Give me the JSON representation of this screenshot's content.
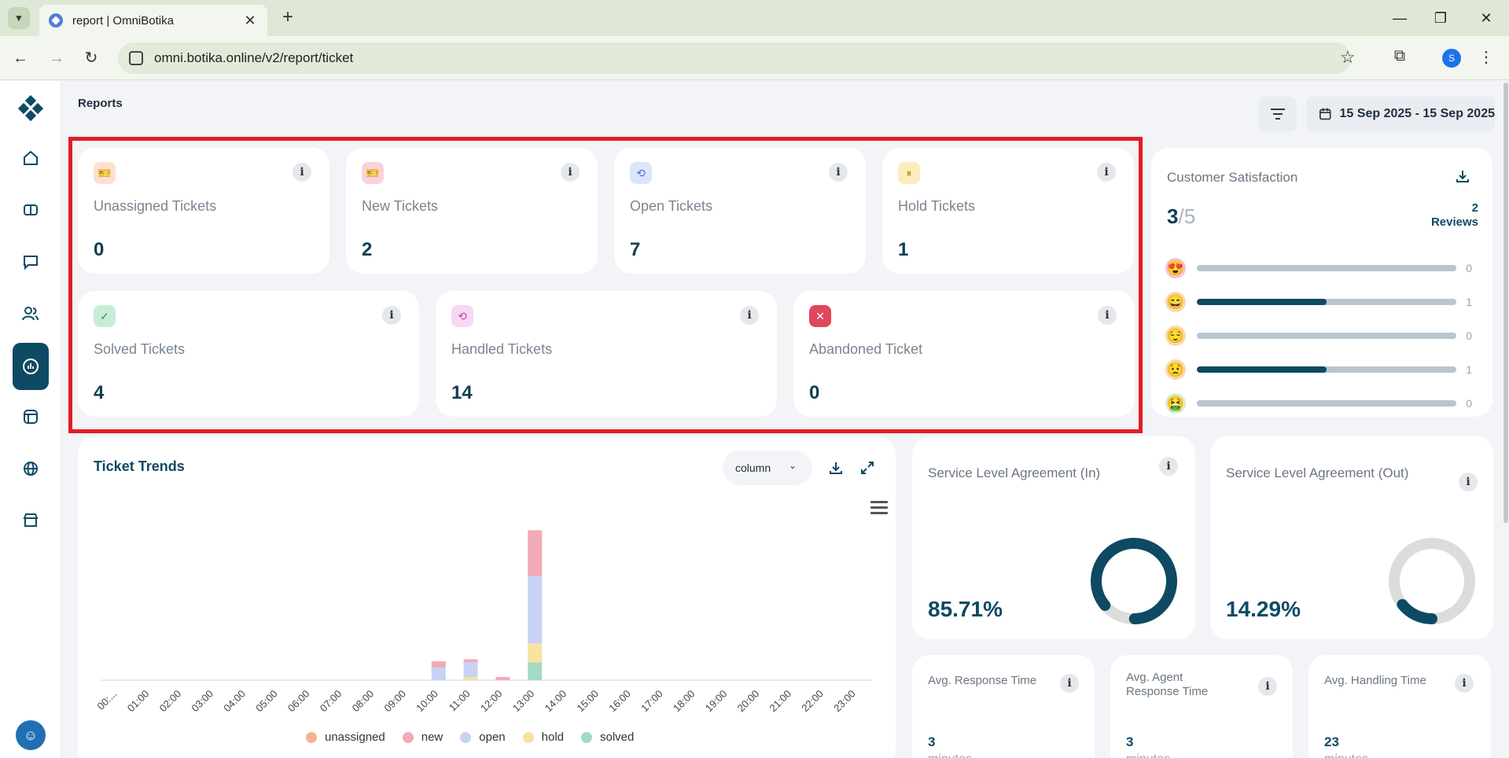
{
  "browser": {
    "tab_title": "report | OmniBotika",
    "url": "omni.botika.online/v2/report/ticket",
    "profile_initial": "S"
  },
  "page": {
    "title": "Reports",
    "date_range": "15 Sep 2025 - 15 Sep 2025"
  },
  "stats": [
    {
      "label": "Unassigned Tickets",
      "value": "0",
      "icon": "ticket-icon",
      "color": "#f6b48e"
    },
    {
      "label": "New Tickets",
      "value": "2",
      "icon": "ticket-new-icon",
      "color": "#f29aa8"
    },
    {
      "label": "Open Tickets",
      "value": "7",
      "icon": "ticket-open-icon",
      "color": "#b4c6f4"
    },
    {
      "label": "Hold Tickets",
      "value": "1",
      "icon": "ticket-hold-icon",
      "color": "#f5dc8a"
    },
    {
      "label": "Solved Tickets",
      "value": "4",
      "icon": "ticket-solved-icon",
      "color": "#8fd3a8"
    },
    {
      "label": "Handled Tickets",
      "value": "14",
      "icon": "ticket-handled-icon",
      "color": "#eab1e6"
    },
    {
      "label": "Abandoned Ticket",
      "value": "0",
      "icon": "ticket-abandoned-icon",
      "color": "#e0475a"
    }
  ],
  "satisfaction": {
    "title": "Customer Satisfaction",
    "score": "3",
    "score_max": "/5",
    "reviews_count": "2",
    "reviews_label": "Reviews",
    "rows": [
      {
        "emoji": "😍",
        "count": "0",
        "fill": 0
      },
      {
        "emoji": "😄",
        "count": "1",
        "fill": 0.5
      },
      {
        "emoji": "😌",
        "count": "0",
        "fill": 0
      },
      {
        "emoji": "😟",
        "count": "1",
        "fill": 0.5
      },
      {
        "emoji": "🤮",
        "count": "0",
        "fill": 0
      }
    ]
  },
  "trends": {
    "title": "Ticket Trends",
    "chart_type_select": "column"
  },
  "chart_data": {
    "type": "bar",
    "stacked": true,
    "categories": [
      "00:...",
      "01:00",
      "02:00",
      "03:00",
      "04:00",
      "05:00",
      "06:00",
      "07:00",
      "08:00",
      "09:00",
      "10:00",
      "11:00",
      "12:00",
      "13:00",
      "14:00",
      "15:00",
      "16:00",
      "17:00",
      "18:00",
      "19:00",
      "20:00",
      "21:00",
      "22:00",
      "23:00"
    ],
    "series": [
      {
        "name": "unassigned",
        "color": "#f6b48e",
        "values": [
          0,
          0,
          0,
          0,
          0,
          0,
          0,
          0,
          0,
          0,
          0,
          0,
          0,
          0,
          0,
          0,
          0,
          0,
          0,
          0,
          0,
          0,
          0,
          0
        ]
      },
      {
        "name": "new",
        "color": "#f4a9b6",
        "values": [
          0,
          0,
          0,
          0,
          0,
          0,
          0,
          0,
          0,
          0,
          0.3,
          0.15,
          0.15,
          2.2,
          0,
          0,
          0,
          0,
          0,
          0,
          0,
          0,
          0,
          0
        ]
      },
      {
        "name": "open",
        "color": "#c7d3f5",
        "values": [
          0,
          0,
          0,
          0,
          0,
          0,
          0,
          0,
          0,
          0,
          0.6,
          0.7,
          0,
          3.2,
          0,
          0,
          0,
          0,
          0,
          0,
          0,
          0,
          0,
          0
        ]
      },
      {
        "name": "hold",
        "color": "#f7e2a0",
        "values": [
          0,
          0,
          0,
          0,
          0,
          0,
          0,
          0,
          0,
          0,
          0,
          0.15,
          0,
          0.9,
          0,
          0,
          0,
          0,
          0,
          0,
          0,
          0,
          0,
          0
        ]
      },
      {
        "name": "solved",
        "color": "#a3d9c5",
        "values": [
          0,
          0,
          0,
          0,
          0,
          0,
          0,
          0,
          0,
          0,
          0,
          0,
          0,
          0.85,
          0,
          0,
          0,
          0,
          0,
          0,
          0,
          0,
          0,
          0
        ]
      }
    ],
    "legend_position": "bottom",
    "ylim": [
      0,
      7.5
    ]
  },
  "sla_in": {
    "title": "Service Level Agreement (In)",
    "value": "85.71%",
    "fraction": 0.8571
  },
  "sla_out": {
    "title": "Service Level Agreement (Out)",
    "value": "14.29%",
    "fraction": 0.1429
  },
  "avg": [
    {
      "title": "Avg. Response Time",
      "value": "3",
      "unit": "minutes"
    },
    {
      "title": "Avg. Agent Response Time",
      "value": "3",
      "unit": "minutes"
    },
    {
      "title": "Avg. Handling Time",
      "value": "23",
      "unit": "minutes"
    }
  ],
  "colors": {
    "accent": "#0e4a63",
    "highlight": "#e31c24"
  }
}
